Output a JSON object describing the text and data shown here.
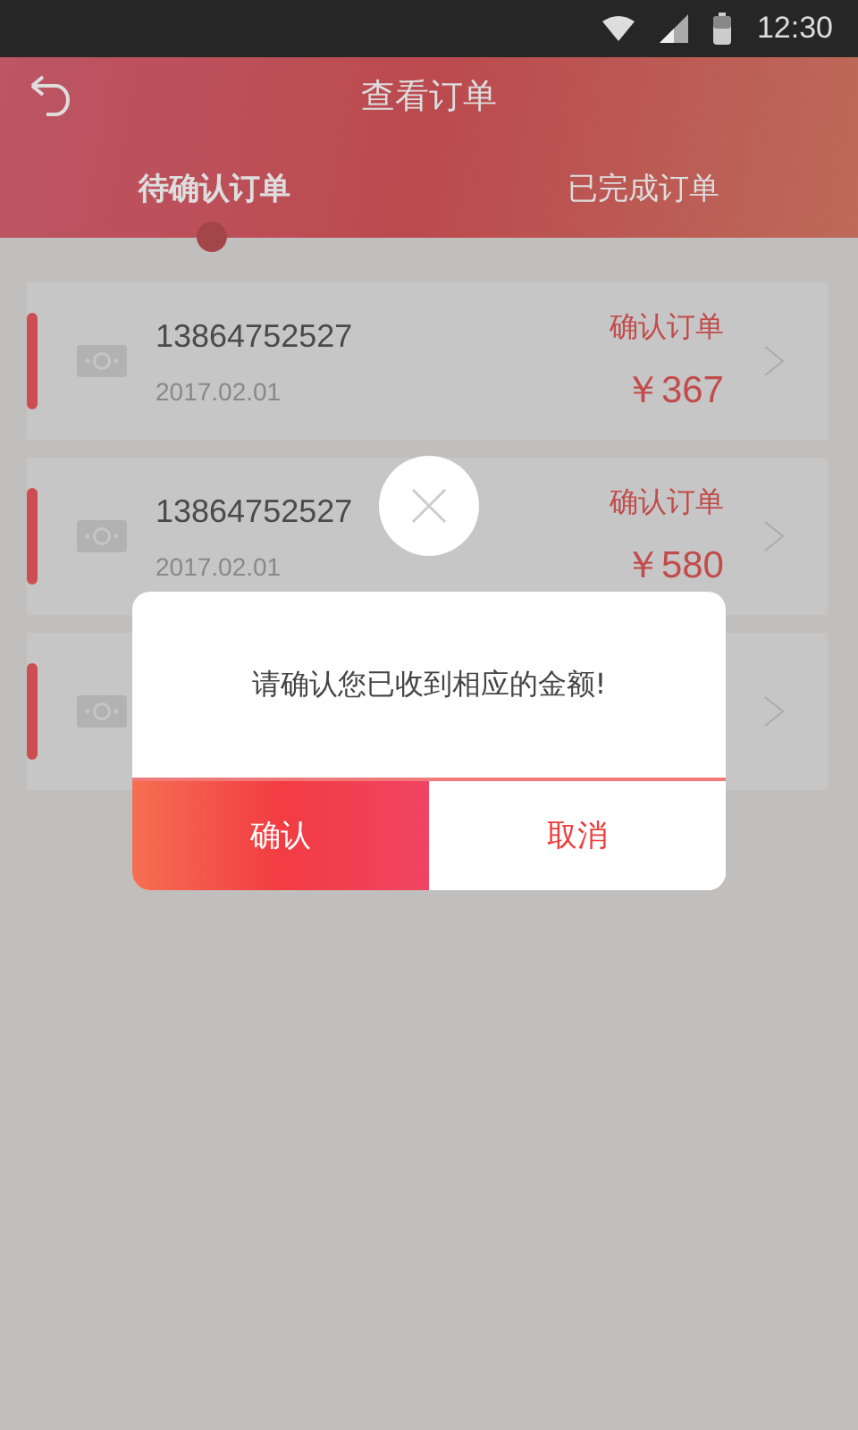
{
  "status_bar": {
    "time": "12:30"
  },
  "header": {
    "title": "查看订单"
  },
  "tabs": [
    {
      "label": "待确认订单",
      "selected": true
    },
    {
      "label": "已完成订单",
      "selected": false
    }
  ],
  "orders": [
    {
      "kind": "visible",
      "phone": "13864752527",
      "date": "2017.02.01",
      "action": "确认订单",
      "amount": "￥367"
    },
    {
      "kind": "visible",
      "phone": "13864752527",
      "date": "2017.02.01",
      "action": "确认订单",
      "amount": "￥580"
    },
    {
      "kind": "covered"
    }
  ],
  "dialog": {
    "message": "请确认您已收到相应的金额!",
    "confirm": "确认",
    "cancel": "取消"
  }
}
